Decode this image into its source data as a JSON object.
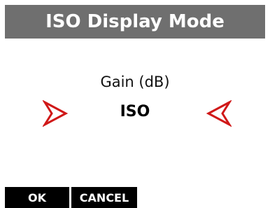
{
  "title": "ISO Display Mode",
  "parameter_label": "Gain (dB)",
  "current_value": "ISO",
  "colors": {
    "title_bar": "#6f6f6f",
    "arrow": "#d01818",
    "softkey_bg": "#000000",
    "softkey_text": "#ffffff"
  },
  "icons": {
    "previous": "chevron-right-outline-icon",
    "next": "chevron-left-outline-icon"
  },
  "softkeys": {
    "ok": "OK",
    "cancel": "CANCEL"
  }
}
